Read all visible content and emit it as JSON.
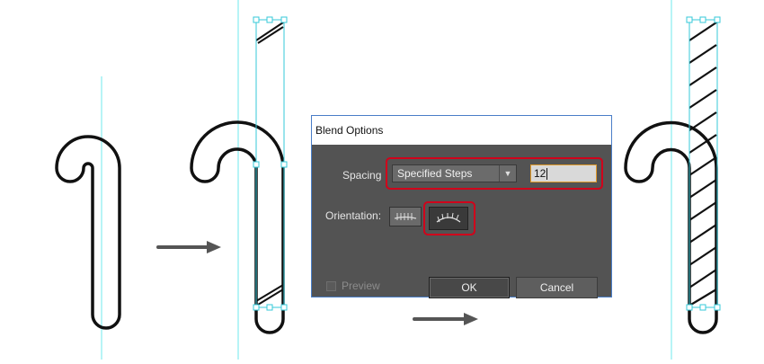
{
  "dialog": {
    "title": "Blend Options",
    "spacing_label": "Spacing",
    "spacing_value": "Specified Steps",
    "steps_value": "12",
    "orientation_label": "Orientation:",
    "preview_label": "Preview",
    "preview_checked": false,
    "ok_label": "OK",
    "cancel_label": "Cancel"
  },
  "colors": {
    "guide": "#6fe8ee",
    "selection": "#35c8d8",
    "highlight": "#d0021b",
    "dialog_bg": "#535353",
    "arrow": "#555555"
  },
  "icons": [
    "align-to-page-icon",
    "align-to-path-icon",
    "dropdown-arrow-icon",
    "arrow-right-icon"
  ]
}
